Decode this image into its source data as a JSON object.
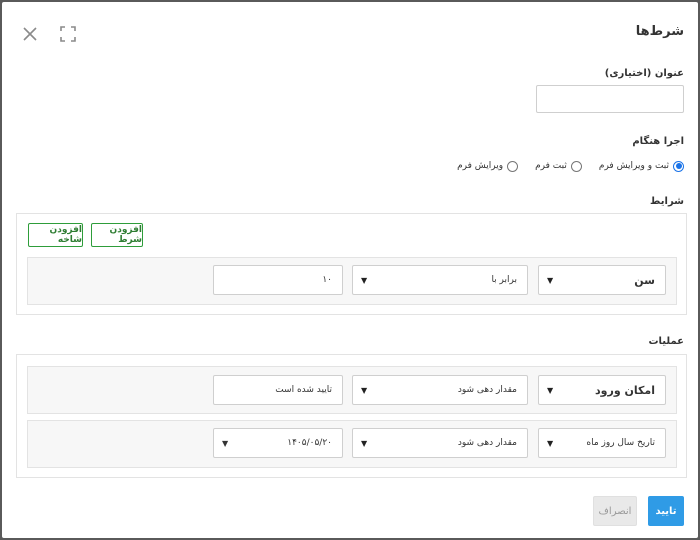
{
  "dialog": {
    "title": "شرط‌ها",
    "close_icon": "close-icon",
    "expand_icon": "fullscreen-icon"
  },
  "title_field": {
    "label": "عنوان (اختیاری)",
    "value": ""
  },
  "run_on": {
    "label": "اجرا هنگام",
    "options": [
      {
        "label": "ثبت و ویرایش فرم",
        "checked": true
      },
      {
        "label": "ثبت فرم",
        "checked": false
      },
      {
        "label": "ویرایش فرم",
        "checked": false
      }
    ]
  },
  "conditions": {
    "label": "شرایط",
    "add_condition_label": "افزودن شرط",
    "add_branch_label": "افزودن شاخه",
    "rows": [
      {
        "field": "سن",
        "operator": "برابر با",
        "value": "۱۰"
      }
    ]
  },
  "operations": {
    "label": "عملیات",
    "rows": [
      {
        "field": "امکان ورود",
        "action": "مقدار دهی شود",
        "value": "تایید شده است"
      },
      {
        "field": "تاریخ سال روز ماه",
        "action": "مقدار دهی شود",
        "value": "۱۴۰۵/۰۵/۲۰"
      }
    ]
  },
  "footer": {
    "ok_label": "تایید",
    "cancel_label": "انصراف"
  },
  "colors": {
    "primary": "#2f9be6",
    "success_border": "#2e9d3a"
  }
}
